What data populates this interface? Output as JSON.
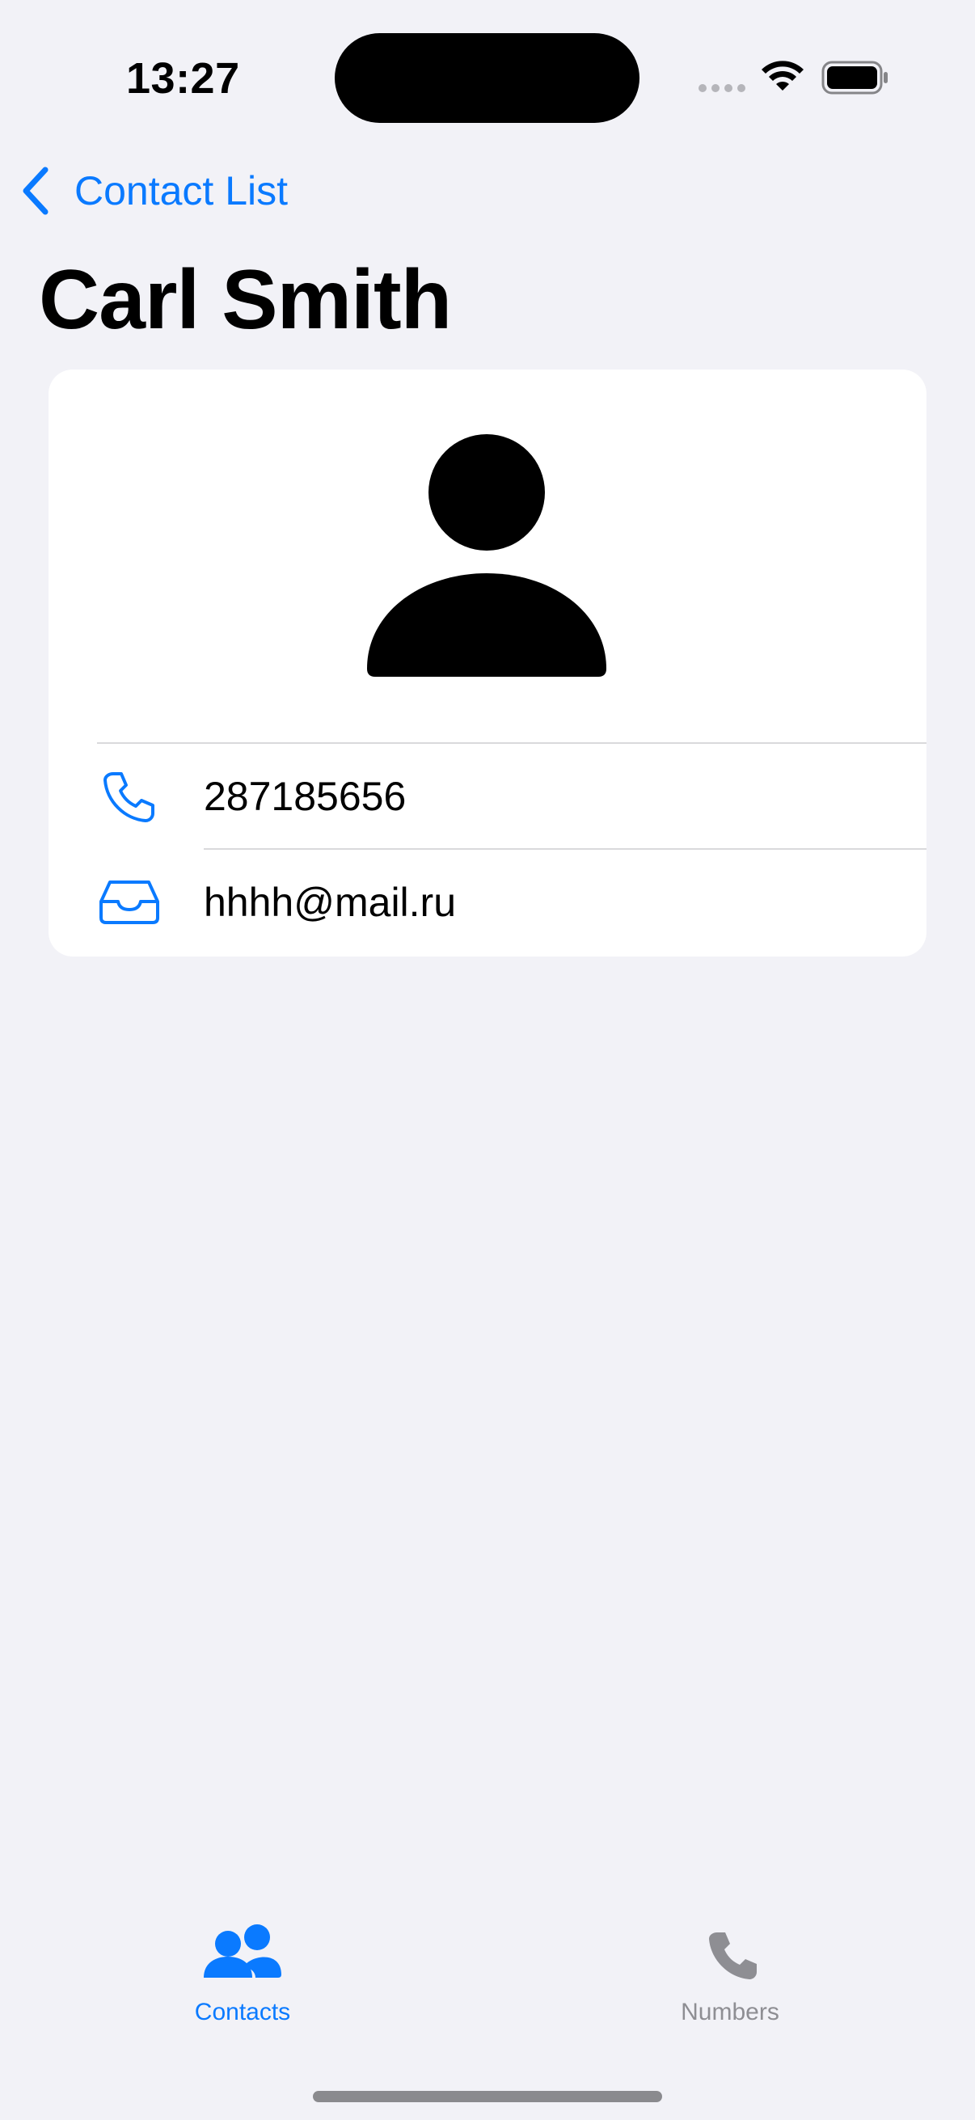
{
  "status_bar": {
    "time": "13:27",
    "icons": [
      "cellular-signal-icon",
      "wifi-icon",
      "battery-icon"
    ]
  },
  "nav": {
    "back_label": "Contact List",
    "back_icon": "chevron-left-icon"
  },
  "contact": {
    "name": "Carl Smith",
    "avatar_icon": "person-icon",
    "phone": "287185656",
    "phone_icon": "phone-icon",
    "email": "hhhh@mail.ru",
    "email_icon": "tray-icon"
  },
  "tab_bar": {
    "tabs": [
      {
        "label": "Contacts",
        "icon": "people-icon",
        "selected": true
      },
      {
        "label": "Numbers",
        "icon": "phone-icon",
        "selected": false
      }
    ]
  },
  "colors": {
    "accent": "#0a7aff",
    "background": "#f2f2f7",
    "card": "#ffffff",
    "inactive": "#8e8e93"
  }
}
